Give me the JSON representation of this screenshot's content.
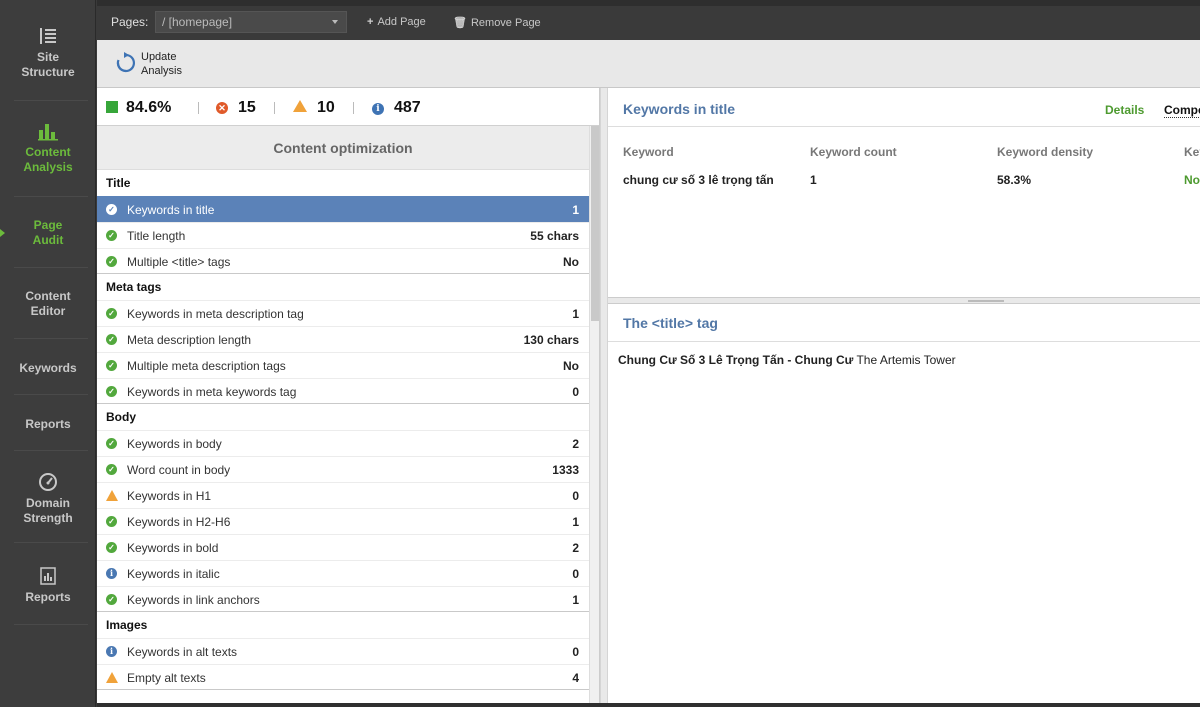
{
  "sidebar": {
    "items": [
      {
        "line1": "Site",
        "line2": "Structure",
        "icon": "list-icon"
      },
      {
        "line1": "Content",
        "line2": "Analysis",
        "icon": "bar-chart-icon"
      },
      {
        "line1": "Page",
        "line2": "Audit",
        "icon": ""
      },
      {
        "line1": "Content",
        "line2": "Editor",
        "icon": ""
      },
      {
        "line1": "Keywords",
        "line2": "",
        "icon": ""
      },
      {
        "line1": "Reports",
        "line2": "",
        "icon": ""
      },
      {
        "line1": "Domain",
        "line2": "Strength",
        "icon": "gauge-icon"
      },
      {
        "line1": "Reports",
        "line2": "",
        "icon": "report-doc-icon"
      }
    ],
    "accent_color": "#6cbb3c"
  },
  "topbar": {
    "pages_label": "Pages:",
    "pages_value": "/ [homepage]",
    "add_page": "Add Page",
    "remove_page": "Remove Page"
  },
  "toolbar": {
    "update_line1": "Update",
    "update_line2": "Analysis"
  },
  "summary": {
    "score": "84.6%",
    "errors": "15",
    "warnings": "10",
    "info": "487"
  },
  "content_optimization": {
    "title": "Content optimization",
    "sections": [
      {
        "name": "Title",
        "rows": [
          {
            "status": "ok",
            "name": "Keywords in title",
            "value": "1",
            "selected": true
          },
          {
            "status": "ok",
            "name": "Title length",
            "value": "55 chars"
          },
          {
            "status": "ok",
            "name": "Multiple <title> tags",
            "value": "No"
          }
        ]
      },
      {
        "name": "Meta tags",
        "rows": [
          {
            "status": "ok",
            "name": "Keywords in meta description tag",
            "value": "1"
          },
          {
            "status": "ok",
            "name": "Meta description length",
            "value": "130 chars"
          },
          {
            "status": "ok",
            "name": "Multiple meta description tags",
            "value": "No"
          },
          {
            "status": "ok",
            "name": "Keywords in meta keywords tag",
            "value": "0"
          }
        ]
      },
      {
        "name": "Body",
        "rows": [
          {
            "status": "ok",
            "name": "Keywords in body",
            "value": "2"
          },
          {
            "status": "ok",
            "name": "Word count in body",
            "value": "1333"
          },
          {
            "status": "warn",
            "name": "Keywords in H1",
            "value": "0"
          },
          {
            "status": "ok",
            "name": "Keywords in H2-H6",
            "value": "1"
          },
          {
            "status": "ok",
            "name": "Keywords in bold",
            "value": "2"
          },
          {
            "status": "info",
            "name": "Keywords in italic",
            "value": "0"
          },
          {
            "status": "ok",
            "name": "Keywords in link anchors",
            "value": "1"
          }
        ]
      },
      {
        "name": "Images",
        "rows": [
          {
            "status": "info",
            "name": "Keywords in alt texts",
            "value": "0"
          },
          {
            "status": "warn",
            "name": "Empty alt texts",
            "value": "4"
          }
        ]
      }
    ]
  },
  "keywords_panel": {
    "title": "Keywords in title",
    "details_link": "Details",
    "compe_link": "Compe",
    "columns": [
      "Keyword",
      "Keyword count",
      "Keyword density",
      "Key"
    ],
    "row": {
      "keyword": "chung cư số 3 lê trọng tấn",
      "count": "1",
      "density": "58.3%",
      "extra": "No"
    }
  },
  "title_tag_panel": {
    "title": "The <title> tag",
    "bold_text": "Chung Cư Số 3 Lê Trọng Tấn - Chung Cư",
    "normal_text": " The Artemis Tower"
  },
  "colors": {
    "ok": "#52a83d",
    "warn": "#f0a23a",
    "info": "#4a78b2",
    "error": "#e05a2a",
    "selection": "#5b82b8",
    "panel_title": "#5277a6"
  }
}
